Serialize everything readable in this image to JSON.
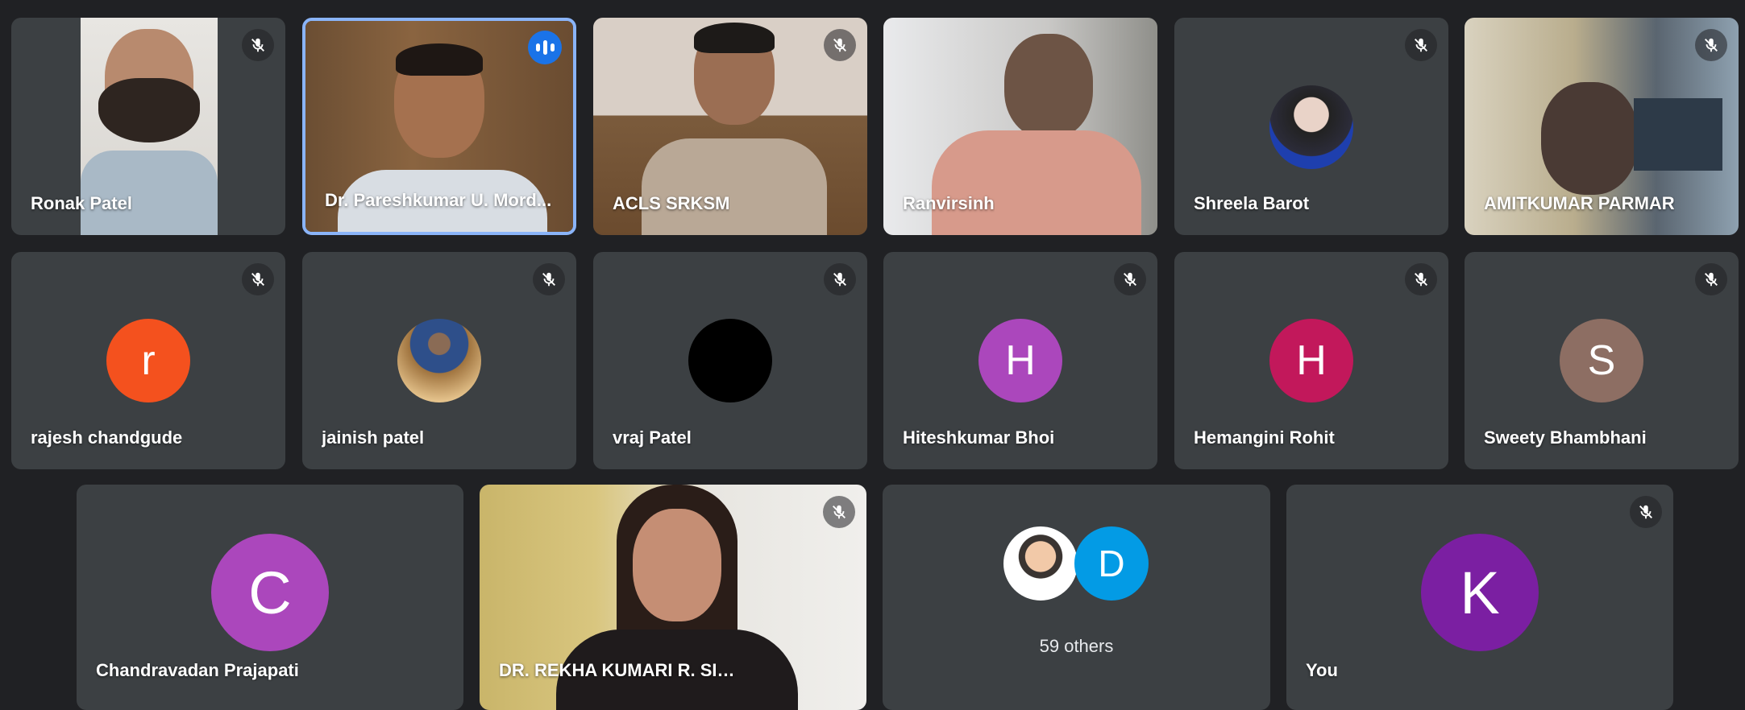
{
  "participants": {
    "ronak": {
      "name": "Ronak Patel"
    },
    "paresh": {
      "name": "Dr. Pareshkumar U. Mord..."
    },
    "acls": {
      "name": "ACLS SRKSM"
    },
    "ranvir": {
      "name": "Ranvirsinh"
    },
    "shreela": {
      "name": "Shreela Barot"
    },
    "amit": {
      "name": "AMITKUMAR PARMAR"
    },
    "rajesh": {
      "name": "rajesh chandgude",
      "initial": "r",
      "color": "#f4511e"
    },
    "jainish": {
      "name": "jainish patel"
    },
    "vraj": {
      "name": "vraj Patel"
    },
    "hitesh": {
      "name": "Hiteshkumar Bhoi",
      "initial": "H",
      "color": "#ab47bc"
    },
    "hemangini": {
      "name": "Hemangini Rohit",
      "initial": "H",
      "color": "#c2185b"
    },
    "sweety": {
      "name": "Sweety Bhambhani",
      "initial": "S",
      "color": "#8d6e63"
    },
    "chandravadan": {
      "name": "Chandravadan Prajapati",
      "initial": "C",
      "color": "#ab47bc"
    },
    "rekha": {
      "name": "DR. REKHA KUMARI R. SINGH"
    },
    "others": {
      "label": "59 others",
      "initial": "D",
      "color": "#039be5"
    },
    "you": {
      "name": "You",
      "initial": "K",
      "color": "#7b1fa2"
    }
  },
  "icons": {
    "muted": "mic-off-icon",
    "speaking": "audio-level-icon"
  }
}
